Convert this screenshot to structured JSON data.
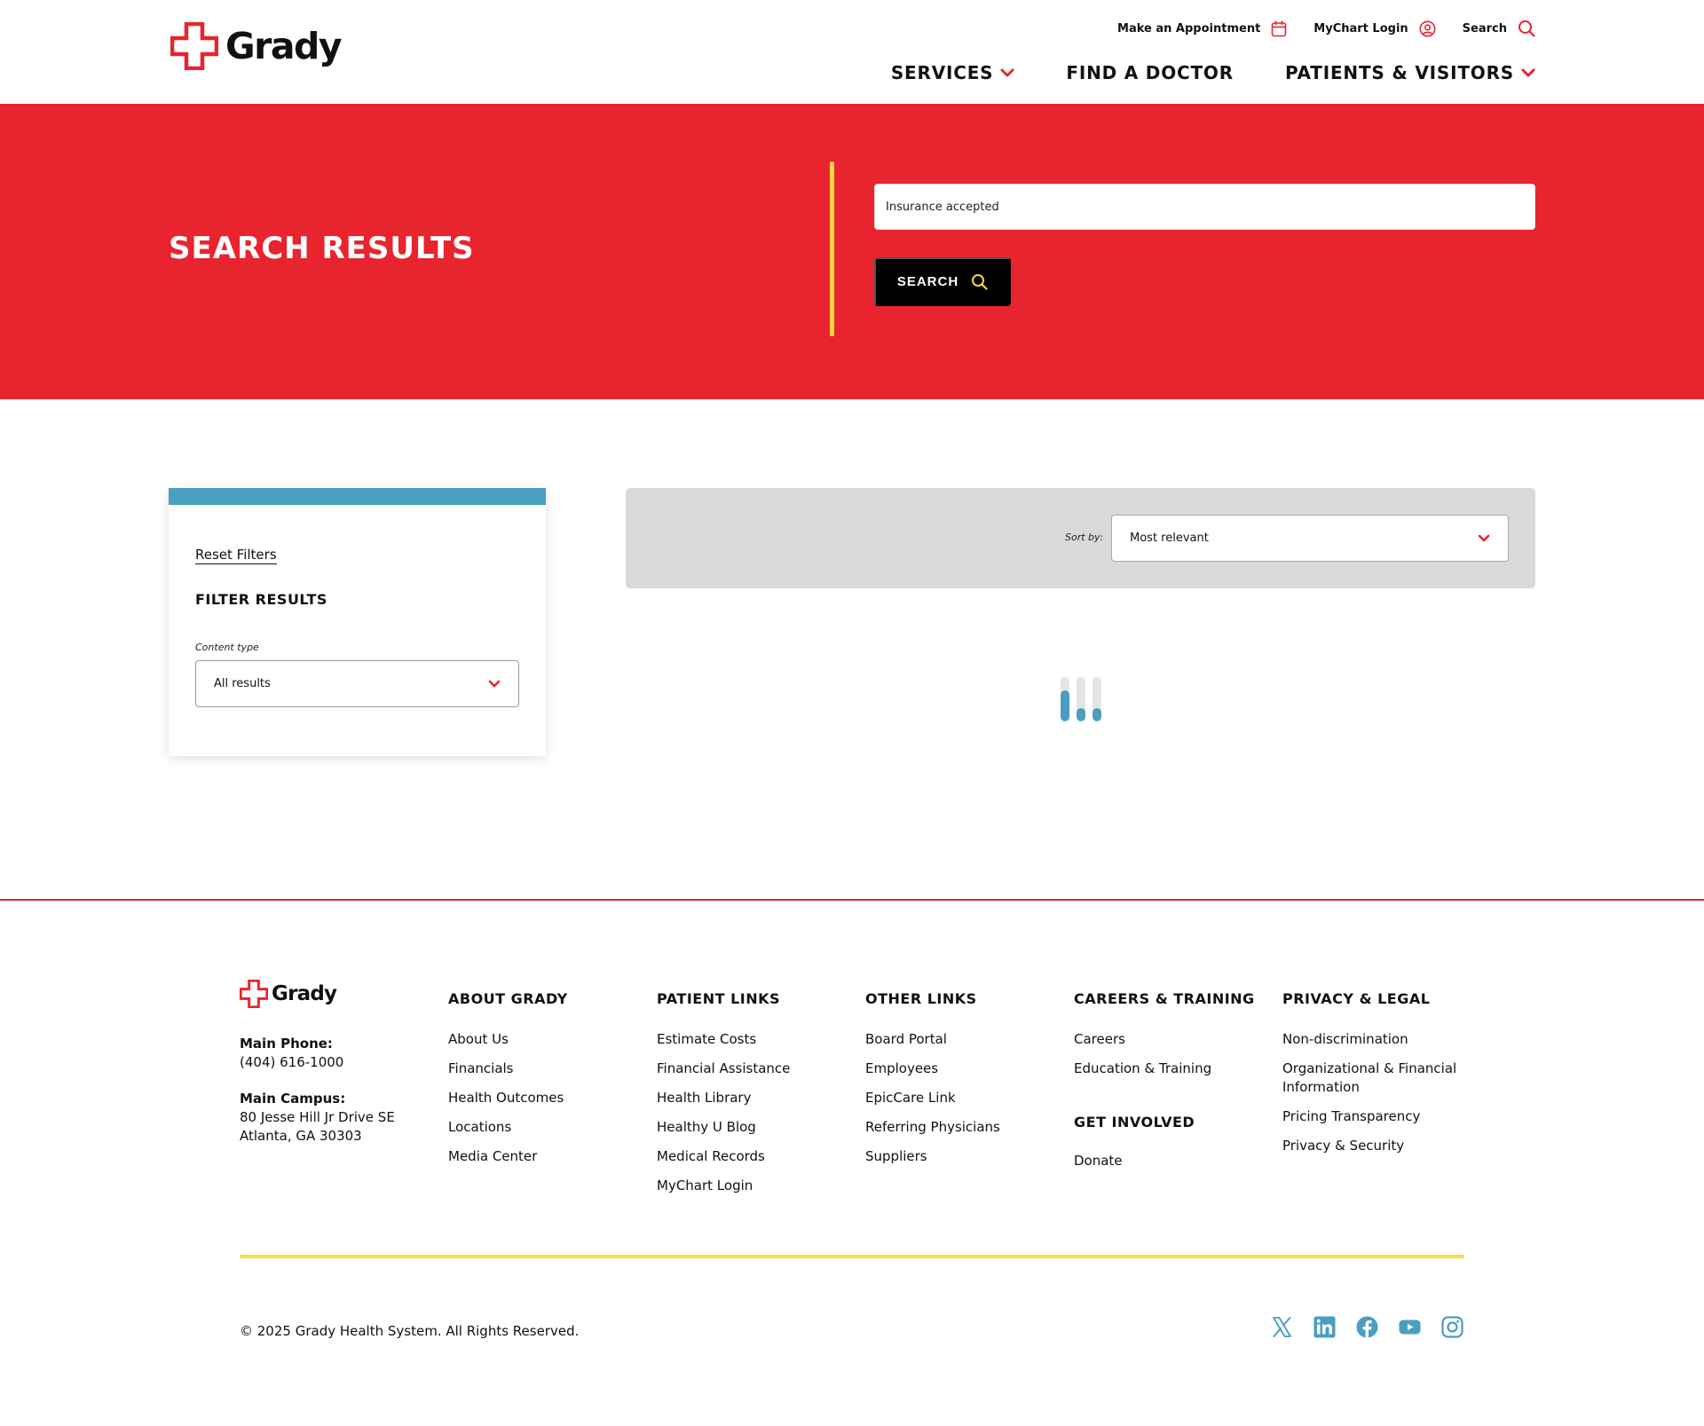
{
  "header": {
    "logo_text": "Grady",
    "utility": {
      "appointment": "Make an Appointment",
      "mychart": "MyChart Login",
      "search": "Search"
    },
    "nav": {
      "services": "SERVICES",
      "find_doctor": "FIND A DOCTOR",
      "patients_visitors": "PATIENTS & VISITORS"
    }
  },
  "hero": {
    "title": "SEARCH RESULTS",
    "search_value": "Insurance accepted",
    "search_button": "SEARCH"
  },
  "filters": {
    "reset": "Reset Filters",
    "heading": "FILTER RESULTS",
    "content_type_label": "Content type",
    "content_type_value": "All results"
  },
  "results": {
    "sort_label": "Sort by:",
    "sort_value": "Most relevant",
    "loading": true
  },
  "footer": {
    "logo_text": "Grady",
    "contact": {
      "phone_label": "Main Phone:",
      "phone": "(404) 616-1000",
      "campus_label": "Main Campus:",
      "address1": "80 Jesse Hill Jr Drive SE",
      "address2": "Atlanta, GA 30303"
    },
    "columns": {
      "about": {
        "title": "ABOUT GRADY",
        "links": [
          "About Us",
          "Financials",
          "Health Outcomes",
          "Locations",
          "Media Center"
        ]
      },
      "patient": {
        "title": "PATIENT LINKS",
        "links": [
          "Estimate Costs",
          "Financial Assistance",
          "Health Library",
          "Healthy U Blog",
          "Medical Records",
          "MyChart Login"
        ]
      },
      "other": {
        "title": "OTHER LINKS",
        "links": [
          "Board Portal",
          "Employees",
          "EpicCare Link",
          "Referring Physicians",
          "Suppliers"
        ]
      },
      "careers": {
        "title": "CAREERS & TRAINING",
        "links": [
          "Careers",
          "Education & Training"
        ]
      },
      "involved": {
        "title": "GET INVOLVED",
        "links": [
          "Donate"
        ]
      },
      "privacy": {
        "title": "PRIVACY & LEGAL",
        "links": [
          "Non-discrimination",
          "Organizational & Financial Information",
          "Pricing Transparency",
          "Privacy & Security"
        ]
      }
    },
    "copyright": "© 2025 Grady Health System. All Rights Reserved.",
    "social_icons": [
      "x-icon",
      "linkedin-icon",
      "facebook-icon",
      "youtube-icon",
      "instagram-icon"
    ]
  },
  "colors": {
    "brand_red": "#e8242f",
    "accent_yellow": "#f5d83b",
    "accent_blue": "#4a9ec0",
    "sort_bar_gray": "#d9d9d9"
  }
}
